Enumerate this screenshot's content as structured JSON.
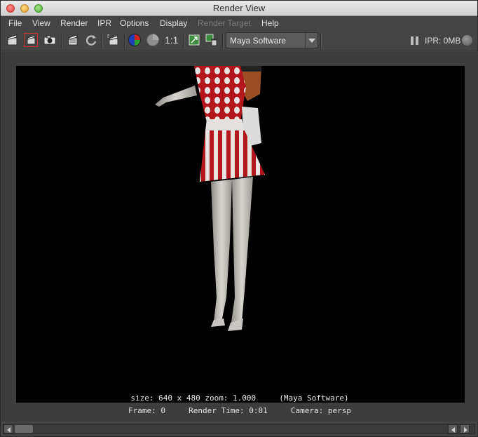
{
  "window": {
    "title": "Render View"
  },
  "menu": {
    "file": "File",
    "view": "View",
    "render": "Render",
    "ipr": "IPR",
    "options": "Options",
    "display": "Display",
    "render_target": "Render Target",
    "help": "Help"
  },
  "toolbar": {
    "icons": [
      "redo-render-icon",
      "render-region-icon",
      "snapshot-icon",
      "ipr-render-icon",
      "refresh-ipr-icon",
      "render-sequence-icon",
      "rgb-channels-icon",
      "alpha-channel-icon",
      "frame-all-icon",
      "keep-image-icon",
      "remove-image-icon"
    ],
    "real_size_label": "1:1",
    "renderer": "Maya Software",
    "ipr_memory": "IPR: 0MB"
  },
  "render_info": {
    "line1": "size: 640 x 480 zoom: 1.000     (Maya Software)",
    "frame": "Frame: 0",
    "render_time": "Render Time: 0:01",
    "camera": "Camera: persp"
  },
  "colors": {
    "dress_red": "#b3161c",
    "skin": "#cfcbc6",
    "hair": "#9b4e24"
  }
}
